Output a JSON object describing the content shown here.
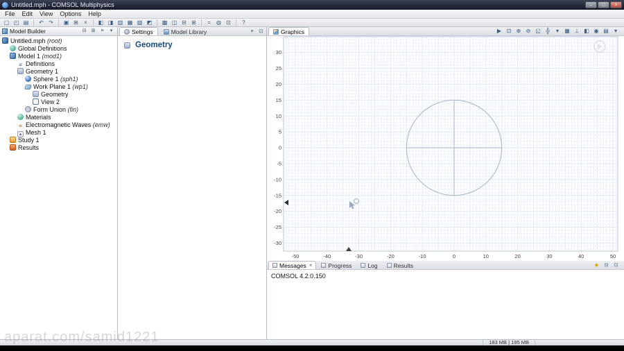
{
  "window": {
    "title": "Untitled.mph - COMSOL Multiphysics",
    "minimize_glyph": "–",
    "maximize_glyph": "□",
    "close_glyph": "×",
    "status_memory": "183 MB | 195 MB"
  },
  "menu": {
    "items": [
      "File",
      "Edit",
      "View",
      "Options",
      "Help"
    ]
  },
  "toolbar": {
    "groups": [
      {
        "icons": [
          {
            "name": "new-file-icon",
            "glyph": "▢"
          },
          {
            "name": "open-file-icon",
            "glyph": "◰"
          },
          {
            "name": "save-icon",
            "glyph": "▤"
          }
        ]
      },
      {
        "icons": [
          {
            "name": "undo-icon",
            "glyph": "↶"
          },
          {
            "name": "redo-icon",
            "glyph": "↷"
          }
        ]
      },
      {
        "icons": [
          {
            "name": "copy-icon",
            "glyph": "▣"
          },
          {
            "name": "paste-icon",
            "glyph": "⊞"
          },
          {
            "name": "delete-icon",
            "glyph": "×"
          }
        ]
      },
      {
        "icons": [
          {
            "name": "model-builder-window-icon",
            "glyph": "◧"
          },
          {
            "name": "settings-window-icon",
            "glyph": "◨"
          },
          {
            "name": "material-browser-icon",
            "glyph": "▥"
          },
          {
            "name": "model-library-window-icon",
            "glyph": "▦"
          },
          {
            "name": "messages-window-icon",
            "glyph": "▧"
          },
          {
            "name": "progress-window-icon",
            "glyph": "◩"
          }
        ]
      },
      {
        "icons": [
          {
            "name": "graphics-window-icon",
            "glyph": "▩"
          },
          {
            "name": "plot-window-icon",
            "glyph": "◫"
          },
          {
            "name": "desktop-layout-icon",
            "glyph": "⊟"
          },
          {
            "name": "reset-desktop-icon",
            "glyph": "⊞"
          }
        ]
      },
      {
        "icons": [
          {
            "name": "compute-icon",
            "glyph": "="
          },
          {
            "name": "plot-icon",
            "glyph": "◍"
          },
          {
            "name": "zoom-extents-toolbar-icon",
            "glyph": "⊡"
          }
        ]
      },
      {
        "icons": [
          {
            "name": "help-icon",
            "glyph": "?"
          }
        ]
      }
    ]
  },
  "model_builder": {
    "title": "Model Builder",
    "header_icons": [
      {
        "name": "collapse-all-icon",
        "glyph": "⊟"
      },
      {
        "name": "expand-all-icon",
        "glyph": "⊞"
      },
      {
        "name": "filter-icon",
        "glyph": "≡"
      },
      {
        "name": "tree-menu-icon",
        "glyph": "▾"
      }
    ],
    "tree": [
      {
        "label": "Untitled.mph",
        "tag": "(root)",
        "level": 0,
        "icon": "root"
      },
      {
        "label": "Global Definitions",
        "tag": "",
        "level": 1,
        "icon": "globe"
      },
      {
        "label": "Model 1",
        "tag": "(mod1)",
        "level": 1,
        "icon": "model"
      },
      {
        "label": "Definitions",
        "tag": "",
        "level": 2,
        "icon": "definitions"
      },
      {
        "label": "Geometry 1",
        "tag": "",
        "level": 2,
        "icon": "geometry"
      },
      {
        "label": "Sphere 1",
        "tag": "(sph1)",
        "level": 3,
        "icon": "sphere"
      },
      {
        "label": "Work Plane 1",
        "tag": "(wp1)",
        "level": 3,
        "icon": "workplane"
      },
      {
        "label": "Geometry",
        "tag": "",
        "level": 4,
        "icon": "geometry"
      },
      {
        "label": "View 2",
        "tag": "",
        "level": 4,
        "icon": "view"
      },
      {
        "label": "Form Union",
        "tag": "(fin)",
        "level": 3,
        "icon": "formunion"
      },
      {
        "label": "Materials",
        "tag": "",
        "level": 2,
        "icon": "materials"
      },
      {
        "label": "Electromagnetic Waves",
        "tag": "(emw)",
        "level": 2,
        "icon": "emw"
      },
      {
        "label": "Mesh 1",
        "tag": "",
        "level": 2,
        "icon": "mesh"
      },
      {
        "label": "Study 1",
        "tag": "",
        "level": 1,
        "icon": "study"
      },
      {
        "label": "Results",
        "tag": "",
        "level": 1,
        "icon": "results"
      }
    ]
  },
  "settings": {
    "tabs": [
      {
        "label": "Settings"
      },
      {
        "label": "Model Library"
      }
    ],
    "header_icons": [
      {
        "name": "settings-menu-icon",
        "glyph": "≡"
      },
      {
        "name": "detach-panel-icon",
        "glyph": "⊡"
      }
    ],
    "heading": "Geometry"
  },
  "graphics": {
    "tab_label": "Graphics",
    "toolbar_icons": [
      {
        "name": "pointer-icon",
        "glyph": "▶"
      },
      {
        "name": "zoom-box-icon",
        "glyph": "⊡"
      },
      {
        "name": "zoom-in-icon",
        "glyph": "⊕"
      },
      {
        "name": "zoom-out-icon",
        "glyph": "⊖"
      },
      {
        "name": "zoom-extents-icon",
        "glyph": "◱"
      },
      {
        "name": "pan-icon",
        "glyph": "╬"
      },
      {
        "name": "go-to-default-view-icon",
        "glyph": "▾"
      },
      {
        "name": "grid-icon",
        "glyph": "▦"
      },
      {
        "name": "axis-orientation-icon",
        "glyph": "⊥"
      },
      {
        "name": "transparency-icon",
        "glyph": "◧"
      },
      {
        "name": "snapshot-icon",
        "glyph": "◉"
      },
      {
        "name": "print-icon",
        "glyph": "▤"
      },
      {
        "name": "graphics-menu-icon",
        "glyph": "▾"
      }
    ],
    "x_ticks": [
      -50,
      -40,
      -30,
      -20,
      -10,
      0,
      10,
      20,
      30,
      40,
      50
    ],
    "y_ticks": [
      30,
      25,
      20,
      15,
      10,
      5,
      0,
      -5,
      -10,
      -15,
      -20,
      -25,
      -30
    ],
    "circle": {
      "cx": 0,
      "cy": 0,
      "r": 15
    }
  },
  "bottom": {
    "tabs": [
      "Messages",
      "Progress",
      "Log",
      "Results"
    ],
    "right_icons": [
      {
        "name": "alert-icon",
        "glyph": "◆",
        "cls": "alert"
      },
      {
        "name": "minimize-panel-icon",
        "glyph": "⊟",
        "cls": ""
      },
      {
        "name": "maximize-panel-icon",
        "glyph": "⊡",
        "cls": ""
      }
    ],
    "content": "COMSOL 4.2.0.150"
  },
  "watermark": {
    "text": "aparat.com/samid1221"
  }
}
